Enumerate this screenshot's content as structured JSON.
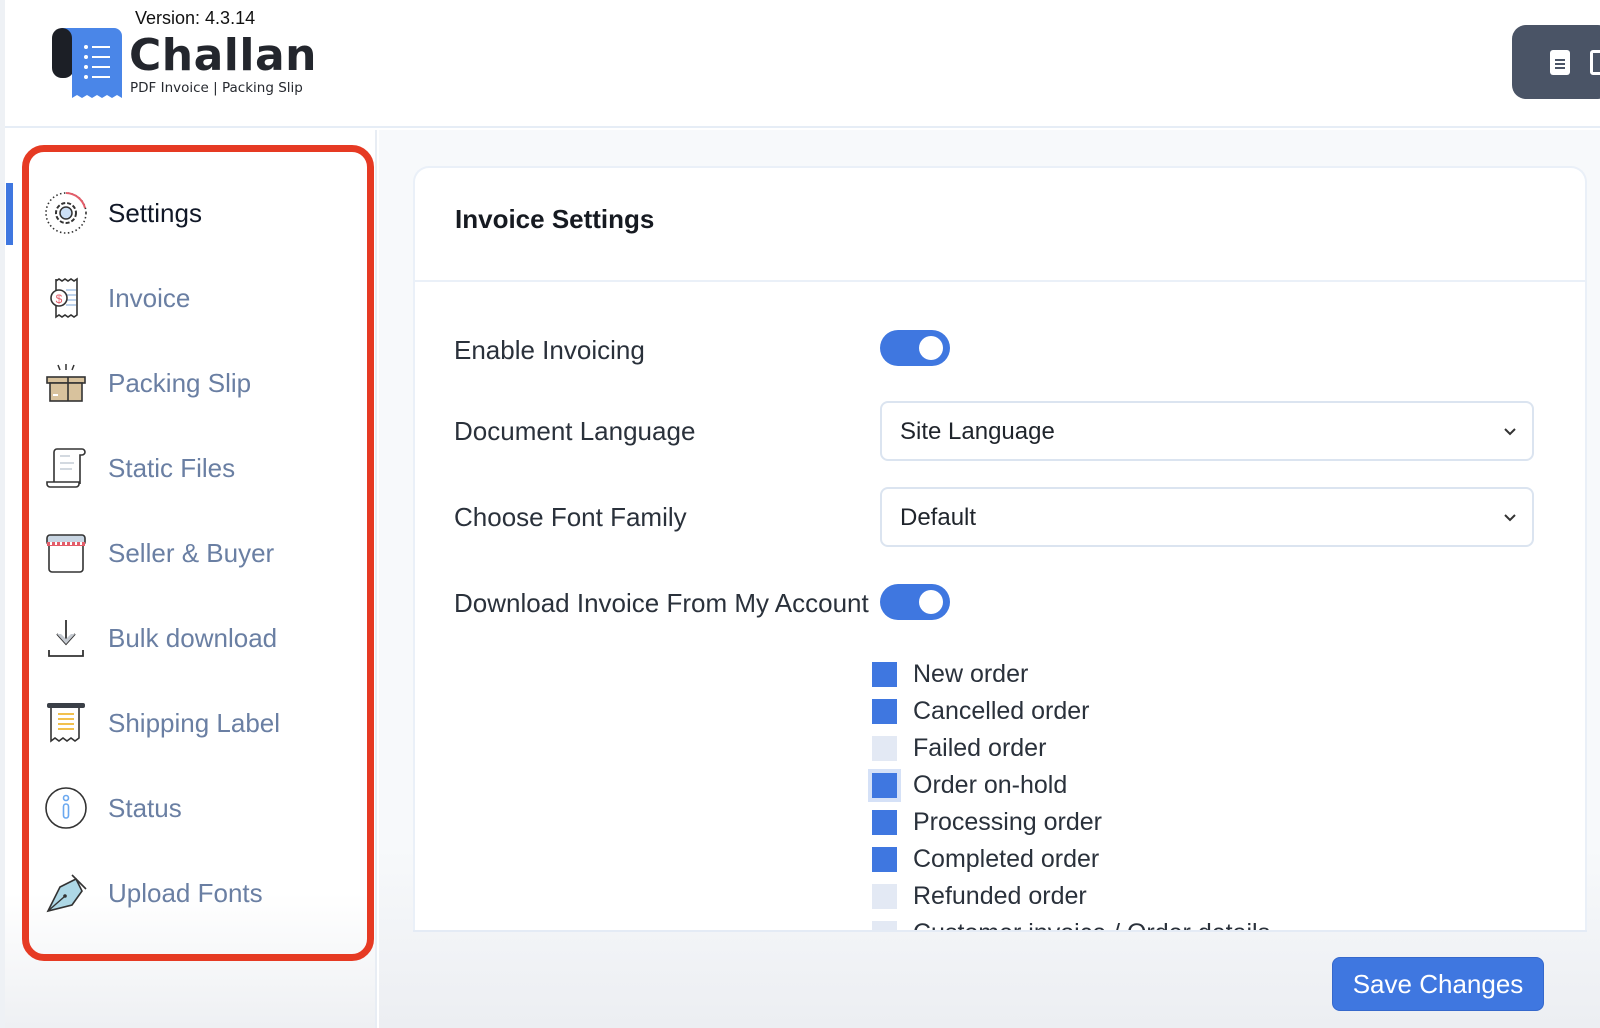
{
  "header": {
    "version": "Version: 4.3.14",
    "logo_title": "Challan",
    "logo_subtitle": "PDF Invoice | Packing Slip",
    "top_button_icon": "document-icon"
  },
  "sidebar": {
    "active": "Settings",
    "items": [
      {
        "label": "Settings",
        "icon": "gear-icon"
      },
      {
        "label": "Invoice",
        "icon": "invoice-receipt-icon"
      },
      {
        "label": "Packing Slip",
        "icon": "box-icon"
      },
      {
        "label": "Static Files",
        "icon": "scroll-icon"
      },
      {
        "label": "Seller & Buyer",
        "icon": "store-icon"
      },
      {
        "label": "Bulk download",
        "icon": "download-icon"
      },
      {
        "label": "Shipping Label",
        "icon": "label-receipt-icon"
      },
      {
        "label": "Status",
        "icon": "info-icon"
      },
      {
        "label": "Upload Fonts",
        "icon": "pen-nib-icon"
      }
    ]
  },
  "main": {
    "card_title": "Invoice Settings",
    "enable_invoicing": {
      "label": "Enable Invoicing",
      "value": true
    },
    "document_language": {
      "label": "Document Language",
      "value": "Site Language"
    },
    "font_family": {
      "label": "Choose Font Family",
      "value": "Default"
    },
    "download_from_account": {
      "label": "Download Invoice From My Account",
      "value": true
    },
    "order_statuses": [
      {
        "label": "New order",
        "checked": true
      },
      {
        "label": "Cancelled order",
        "checked": true
      },
      {
        "label": "Failed order",
        "checked": false
      },
      {
        "label": "Order on-hold",
        "checked": true
      },
      {
        "label": "Processing order",
        "checked": true
      },
      {
        "label": "Completed order",
        "checked": true
      },
      {
        "label": "Refunded order",
        "checked": false
      },
      {
        "label": "Customer invoice / Order details",
        "checked": false
      }
    ],
    "save_label": "Save Changes"
  },
  "colors": {
    "accent": "#3f77e0",
    "highlight": "#e63a23",
    "nav_text": "#6a7fa3"
  }
}
